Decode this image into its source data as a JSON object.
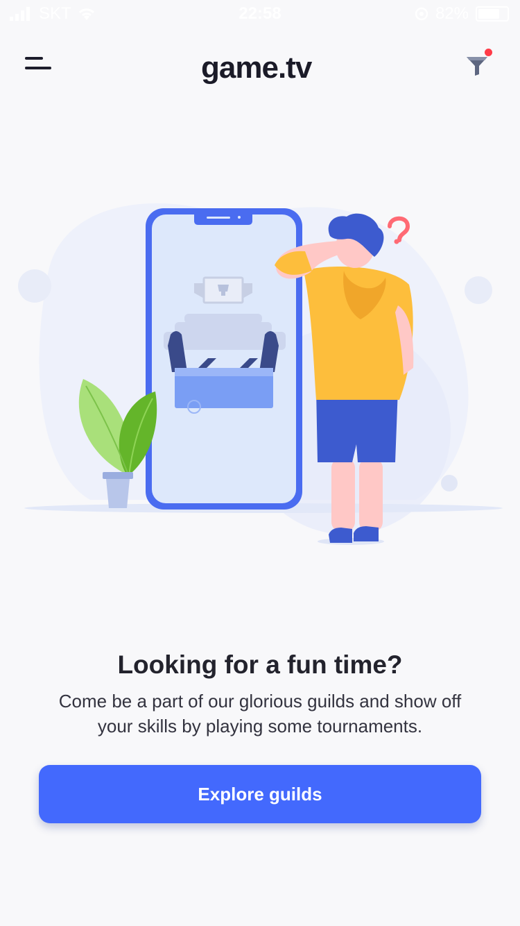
{
  "status_bar": {
    "carrier": "SKT",
    "time": "22:58",
    "battery_percent": "82%",
    "battery_level": 0.82,
    "icons": [
      "signal-icon",
      "wifi-icon",
      "alarm-icon",
      "battery-icon"
    ]
  },
  "header": {
    "logo_text": "game.tv",
    "menu_icon": "hamburger-menu-icon",
    "filter_icon": "filter-icon",
    "filter_has_notification": true
  },
  "empty_state": {
    "headline": "Looking for a fun time?",
    "body": "Come be a part of our glorious guilds and show off your skills by playing some tournaments.",
    "cta_label": "Explore guilds"
  },
  "colors": {
    "accent": "#4369fd",
    "notification": "#ff3b48",
    "background": "#f8f8fa"
  }
}
